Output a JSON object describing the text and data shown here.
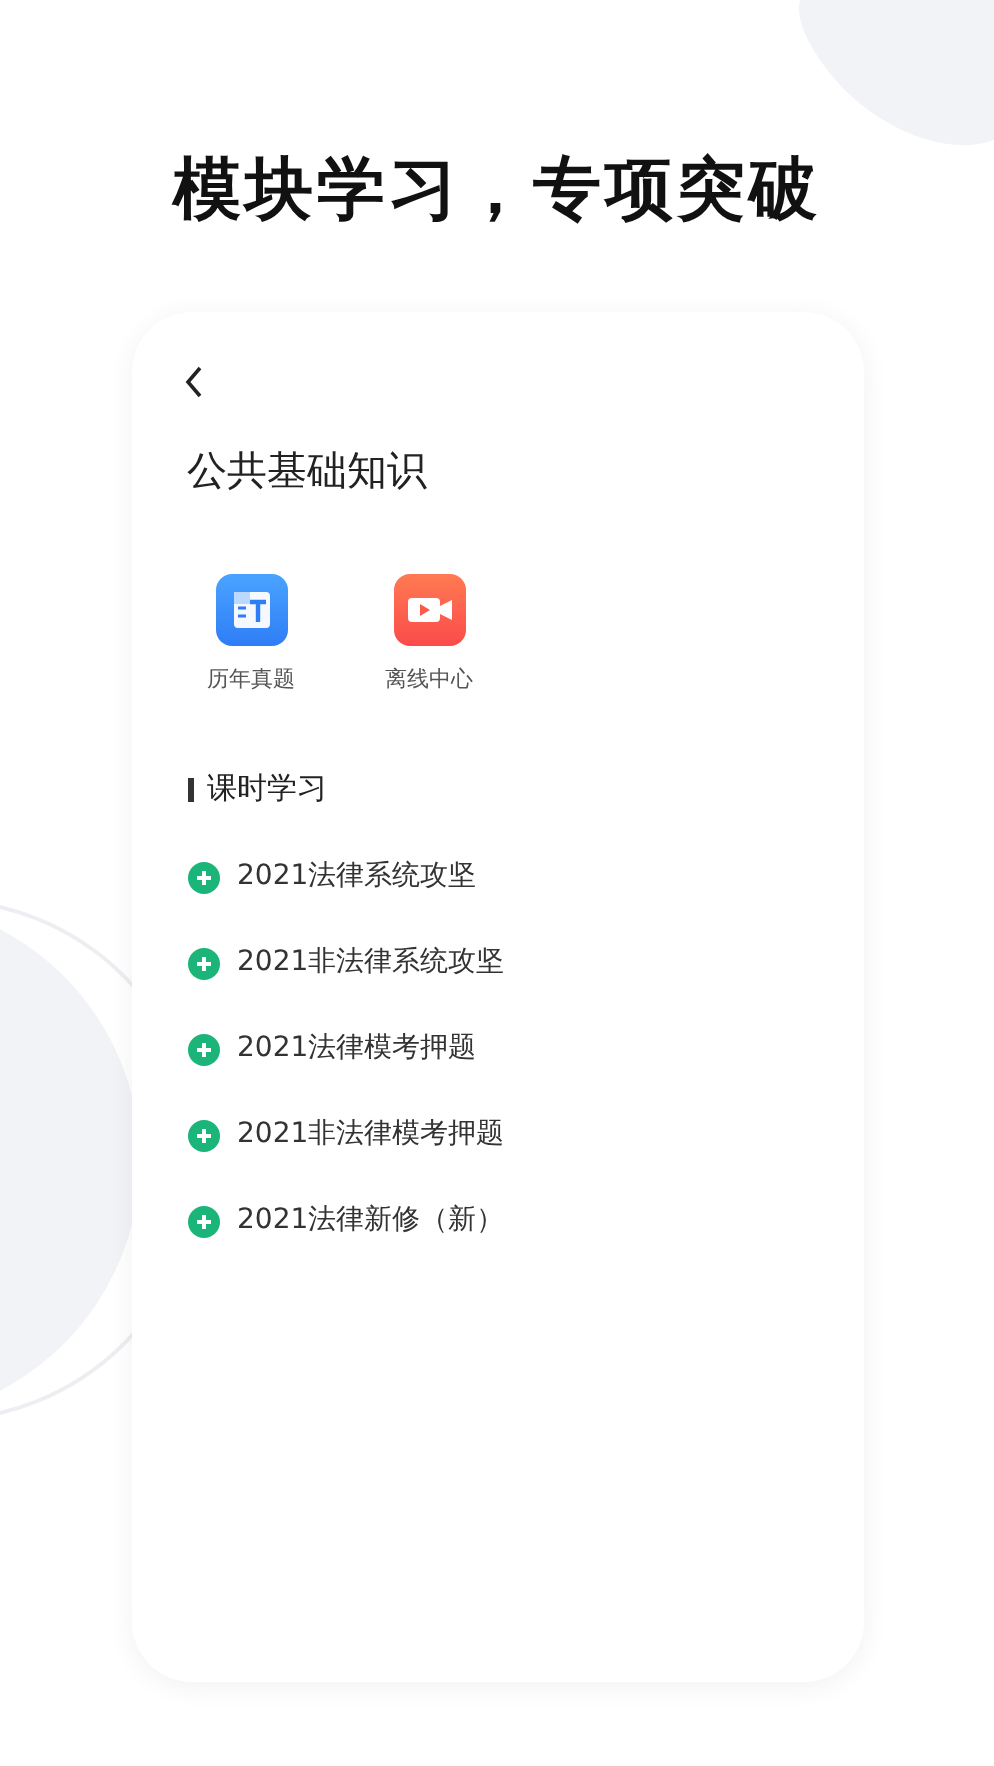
{
  "headline": "模块学习，专项突破",
  "page": {
    "title": "公共基础知识"
  },
  "shortcuts": [
    {
      "kind": "exam",
      "label": "历年真题"
    },
    {
      "kind": "video",
      "label": "离线中心"
    }
  ],
  "section": {
    "title": "课时学习"
  },
  "courses": [
    "2021法律系统攻坚",
    "2021非法律系统攻坚",
    "2021法律模考押题",
    "2021非法律模考押题",
    "2021法律新修（新）"
  ]
}
